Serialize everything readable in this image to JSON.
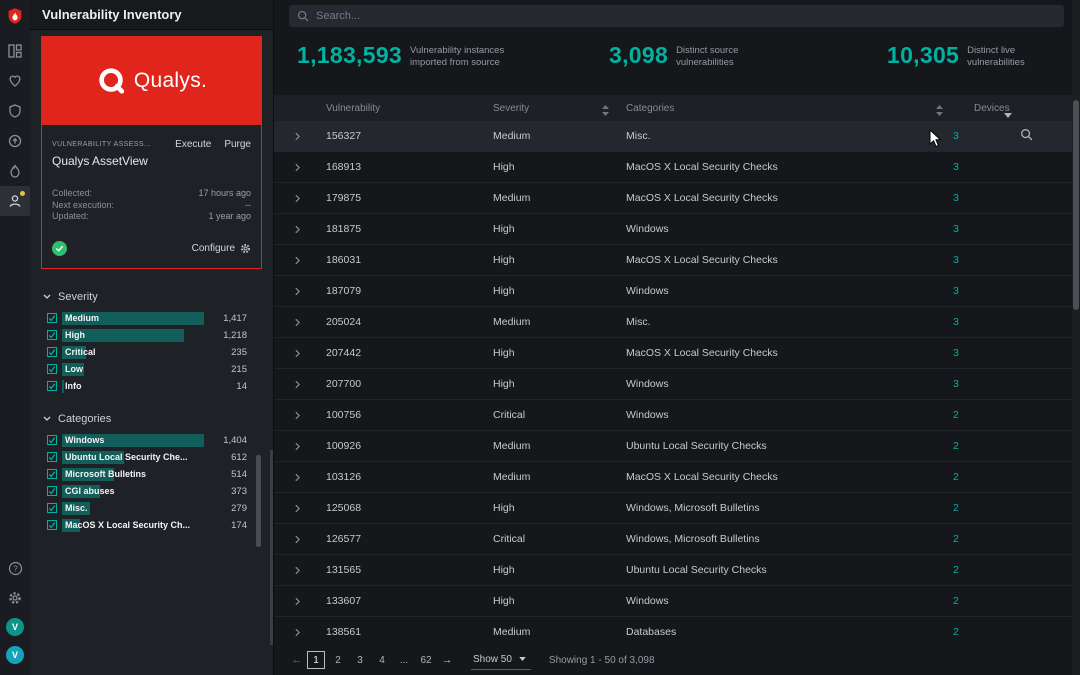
{
  "colors": {
    "accent": "#00b2a1",
    "brand_red": "#e0251c",
    "success_green": "#2fbf71",
    "notification_yellow": "#e8c341"
  },
  "rail": {
    "avatar_label": "V"
  },
  "sidebar": {
    "title": "Vulnerability Inventory",
    "source_card": {
      "brand": "Qualys.",
      "type_label": "VULNERABILITY ASSESS...",
      "execute_label": "Execute",
      "purge_label": "Purge",
      "name": "Qualys AssetView",
      "fields": [
        {
          "label": "Collected:",
          "value": "17 hours ago"
        },
        {
          "label": "Next execution:",
          "value": "--"
        },
        {
          "label": "Updated:",
          "value": "1 year ago"
        }
      ],
      "configure_label": "Configure"
    },
    "filters": [
      {
        "title": "Severity",
        "items": [
          {
            "label": "Medium",
            "count": "1,417",
            "checked": true
          },
          {
            "label": "High",
            "count": "1,218",
            "checked": true
          },
          {
            "label": "Critical",
            "count": "235",
            "checked": true
          },
          {
            "label": "Low",
            "count": "215",
            "checked": true
          },
          {
            "label": "Info",
            "count": "14",
            "checked": true
          }
        ]
      },
      {
        "title": "Categories",
        "items": [
          {
            "label": "Windows",
            "count": "1,404",
            "checked": true
          },
          {
            "label": "Ubuntu Local Security Che...",
            "count": "612",
            "checked": true
          },
          {
            "label": "Microsoft Bulletins",
            "count": "514",
            "checked": true
          },
          {
            "label": "CGI abuses",
            "count": "373",
            "checked": true
          },
          {
            "label": "Misc.",
            "count": "279",
            "checked": true
          },
          {
            "label": "MacOS X Local Security Ch...",
            "count": "174",
            "checked": true
          }
        ]
      }
    ]
  },
  "search": {
    "placeholder": "Search..."
  },
  "stats": [
    {
      "value": "1,183,593",
      "label": "Vulnerability instances imported from source"
    },
    {
      "value": "3,098",
      "label": "Distinct source vulnerabilities"
    },
    {
      "value": "10,305",
      "label": "Distinct live vulnerabilities"
    }
  ],
  "table": {
    "columns": [
      "Vulnerability",
      "Severity",
      "Categories",
      "Devices"
    ],
    "rows": [
      {
        "vulnerability": "156327",
        "severity": "Medium",
        "categories": "Misc.",
        "devices": "3"
      },
      {
        "vulnerability": "168913",
        "severity": "High",
        "categories": "MacOS X Local Security Checks",
        "devices": "3"
      },
      {
        "vulnerability": "179875",
        "severity": "Medium",
        "categories": "MacOS X Local Security Checks",
        "devices": "3"
      },
      {
        "vulnerability": "181875",
        "severity": "High",
        "categories": "Windows",
        "devices": "3"
      },
      {
        "vulnerability": "186031",
        "severity": "High",
        "categories": "MacOS X Local Security Checks",
        "devices": "3"
      },
      {
        "vulnerability": "187079",
        "severity": "High",
        "categories": "Windows",
        "devices": "3"
      },
      {
        "vulnerability": "205024",
        "severity": "Medium",
        "categories": "Misc.",
        "devices": "3"
      },
      {
        "vulnerability": "207442",
        "severity": "High",
        "categories": "MacOS X Local Security Checks",
        "devices": "3"
      },
      {
        "vulnerability": "207700",
        "severity": "High",
        "categories": "Windows",
        "devices": "3"
      },
      {
        "vulnerability": "100756",
        "severity": "Critical",
        "categories": "Windows",
        "devices": "2"
      },
      {
        "vulnerability": "100926",
        "severity": "Medium",
        "categories": "Ubuntu Local Security Checks",
        "devices": "2"
      },
      {
        "vulnerability": "103126",
        "severity": "Medium",
        "categories": "MacOS X Local Security Checks",
        "devices": "2"
      },
      {
        "vulnerability": "125068",
        "severity": "High",
        "categories": "Windows, Microsoft Bulletins",
        "devices": "2"
      },
      {
        "vulnerability": "126577",
        "severity": "Critical",
        "categories": "Windows, Microsoft Bulletins",
        "devices": "2"
      },
      {
        "vulnerability": "131565",
        "severity": "High",
        "categories": "Ubuntu Local Security Checks",
        "devices": "2"
      },
      {
        "vulnerability": "133607",
        "severity": "High",
        "categories": "Windows",
        "devices": "2"
      },
      {
        "vulnerability": "138561",
        "severity": "Medium",
        "categories": "Databases",
        "devices": "2"
      }
    ]
  },
  "pagination": {
    "prev": "←",
    "next": "→",
    "pages": [
      "1",
      "2",
      "3",
      "4",
      "...",
      "62"
    ],
    "current": "1",
    "page_size_label": "Show 50",
    "summary": "Showing 1 - 50 of 3,098"
  }
}
